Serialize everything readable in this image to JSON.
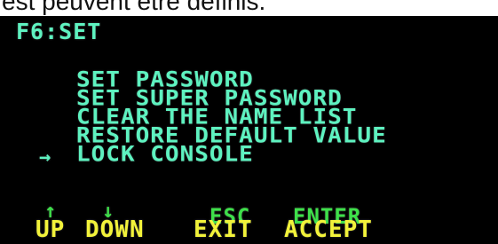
{
  "caption": "est peuvent être définis.",
  "osd": {
    "title": "F6:SET",
    "menu": [
      "SET PASSWORD",
      "SET SUPER PASSWORD",
      "CLEAR THE NAME LIST",
      "RESTORE DEFAULT VALUE",
      "LOCK CONSOLE"
    ],
    "cursor": "→",
    "selected_index": 4,
    "hints": [
      {
        "key": "↑",
        "action": "UP"
      },
      {
        "key": "↓",
        "action": "DOWN"
      },
      {
        "key": "ESC",
        "action": "EXIT"
      },
      {
        "key": "ENTER",
        "action": "ACCEPT"
      }
    ],
    "colors": {
      "background": "#000000",
      "menu_text": "#5ef2c0",
      "hint_key": "#3ee04a",
      "hint_action": "#f2f23a"
    }
  }
}
